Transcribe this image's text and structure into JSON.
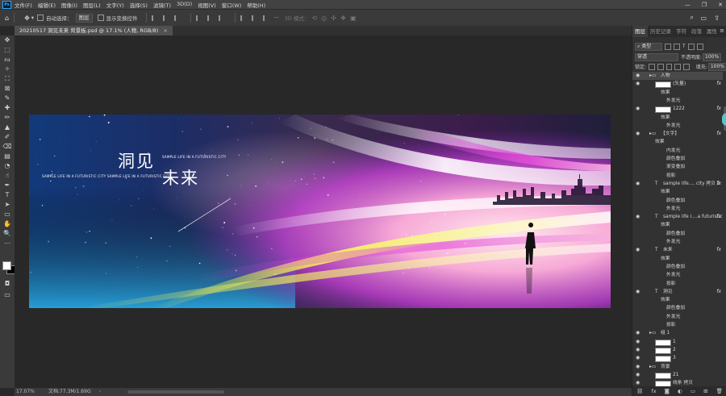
{
  "app": {
    "logo": "Ps"
  },
  "menu": [
    "文件(F)",
    "编辑(E)",
    "图像(I)",
    "图层(L)",
    "文字(Y)",
    "选择(S)",
    "滤镜(T)",
    "3D(D)",
    "视图(V)",
    "窗口(W)",
    "帮助(H)"
  ],
  "window_controls": [
    "—",
    "❐",
    "✕"
  ],
  "options": {
    "auto_select_label": "自动选择：",
    "auto_select_value": "图层",
    "transform_label": "显示变换控件",
    "mode_3d_label": "3D 模式："
  },
  "tab": {
    "title": "20210517 洞见未来 背景板.psd @ 17.1% (人物, RGB/8)",
    "close": "×"
  },
  "status": {
    "zoom": "17.07%",
    "doc": "文档:77.3M/1.69G",
    "arrow": "›"
  },
  "artboard": {
    "title1": "洞见",
    "title2": "未来",
    "sample_right": "SAMPLE LIFE IN A FUTURISTIC CITY",
    "sample_left": "SAMPLE LIFE IN A FUTURISTIC CITY   SAMPLE LIFE IN A FUTURISTIC CITY"
  },
  "panel": {
    "tabs": [
      "图层",
      "历史记录",
      "字符",
      "段落",
      "属性"
    ],
    "filter_kind": "类型",
    "blend_mode": "穿透",
    "opacity_label": "不透明度:",
    "opacity_value": "100%",
    "lock_label": "锁定:",
    "fill_label": "填充:",
    "fill_value": "100%"
  },
  "layers": [
    {
      "name": "人物",
      "indent": 1,
      "eye": true,
      "folder": true,
      "selected": true,
      "fx": false
    },
    {
      "name": "(矢量)",
      "indent": 2,
      "eye": true,
      "thumb": true,
      "fx": true
    },
    {
      "name": "效果",
      "indent": 3,
      "eye": false,
      "fx": false
    },
    {
      "name": "外发光",
      "indent": 4,
      "eye": false,
      "fx": false
    },
    {
      "name": "1222",
      "indent": 2,
      "eye": true,
      "thumb": true,
      "fx": true
    },
    {
      "name": "效果",
      "indent": 3,
      "eye": false,
      "fx": false
    },
    {
      "name": "外发光",
      "indent": 4,
      "eye": false,
      "fx": false
    },
    {
      "name": "【文字】",
      "indent": 1,
      "eye": true,
      "folder": true,
      "fx": true
    },
    {
      "name": "效果",
      "indent": 2,
      "eye": false,
      "fx": false
    },
    {
      "name": "内发光",
      "indent": 4,
      "eye": false,
      "fx": false
    },
    {
      "name": "颜色叠加",
      "indent": 4,
      "eye": false,
      "fx": false
    },
    {
      "name": "渐变叠加",
      "indent": 4,
      "eye": false,
      "fx": false
    },
    {
      "name": "投影",
      "indent": 4,
      "eye": false,
      "fx": false
    },
    {
      "name": "sample life.... city 拷贝 2",
      "indent": 2,
      "eye": true,
      "type": true,
      "fx": true
    },
    {
      "name": "效果",
      "indent": 3,
      "eye": false,
      "fx": false
    },
    {
      "name": "颜色叠加",
      "indent": 4,
      "eye": false,
      "fx": false
    },
    {
      "name": "外发光",
      "indent": 4,
      "eye": false,
      "fx": false
    },
    {
      "name": "sample life i....a futuristic",
      "indent": 2,
      "eye": true,
      "type": true,
      "fx": true
    },
    {
      "name": "效果",
      "indent": 3,
      "eye": false,
      "fx": false
    },
    {
      "name": "颜色叠加",
      "indent": 4,
      "eye": false,
      "fx": false
    },
    {
      "name": "外发光",
      "indent": 4,
      "eye": false,
      "fx": false
    },
    {
      "name": "未来",
      "indent": 2,
      "eye": true,
      "type": true,
      "fx": true
    },
    {
      "name": "效果",
      "indent": 3,
      "eye": false,
      "fx": false
    },
    {
      "name": "颜色叠加",
      "indent": 4,
      "eye": false,
      "fx": false
    },
    {
      "name": "外发光",
      "indent": 4,
      "eye": false,
      "fx": false
    },
    {
      "name": "投影",
      "indent": 4,
      "eye": false,
      "fx": false
    },
    {
      "name": "洞见",
      "indent": 2,
      "eye": true,
      "type": true,
      "fx": true
    },
    {
      "name": "效果",
      "indent": 3,
      "eye": false,
      "fx": false
    },
    {
      "name": "颜色叠加",
      "indent": 4,
      "eye": false,
      "fx": false
    },
    {
      "name": "外发光",
      "indent": 4,
      "eye": false,
      "fx": false
    },
    {
      "name": "投影",
      "indent": 4,
      "eye": false,
      "fx": false
    },
    {
      "name": "组 1",
      "indent": 1,
      "eye": true,
      "folder": true,
      "fx": false
    },
    {
      "name": "1",
      "indent": 2,
      "eye": true,
      "thumb": true,
      "fx": false
    },
    {
      "name": "2",
      "indent": 2,
      "eye": true,
      "thumb": true,
      "fx": false
    },
    {
      "name": "3",
      "indent": 2,
      "eye": true,
      "thumb": true,
      "fx": false
    },
    {
      "name": "背景",
      "indent": 1,
      "eye": true,
      "folder": true,
      "fx": false
    },
    {
      "name": "21",
      "indent": 2,
      "eye": true,
      "thumb": true,
      "fx": false
    },
    {
      "name": "线条 拷贝",
      "indent": 2,
      "eye": true,
      "thumb": true,
      "fx": false
    }
  ],
  "footer_icons": [
    "link-icon",
    "fx-icon",
    "mask-icon",
    "adjustment-icon",
    "folder-icon",
    "new-layer-icon",
    "trash-icon"
  ],
  "footer_glyphs": [
    "⛓",
    "fx",
    "◙",
    "◐",
    "▭",
    "⊞",
    "🗑"
  ],
  "tools": [
    "✥",
    "⬚",
    "ᔓ",
    "✧",
    "⛶",
    "⊠",
    "✎",
    "✚",
    "✏",
    "▲",
    "✐",
    "⌫",
    "▤",
    "◔",
    "☝",
    "✒",
    "T",
    "➤",
    "▭",
    "✋",
    "🔍",
    "⋯"
  ]
}
